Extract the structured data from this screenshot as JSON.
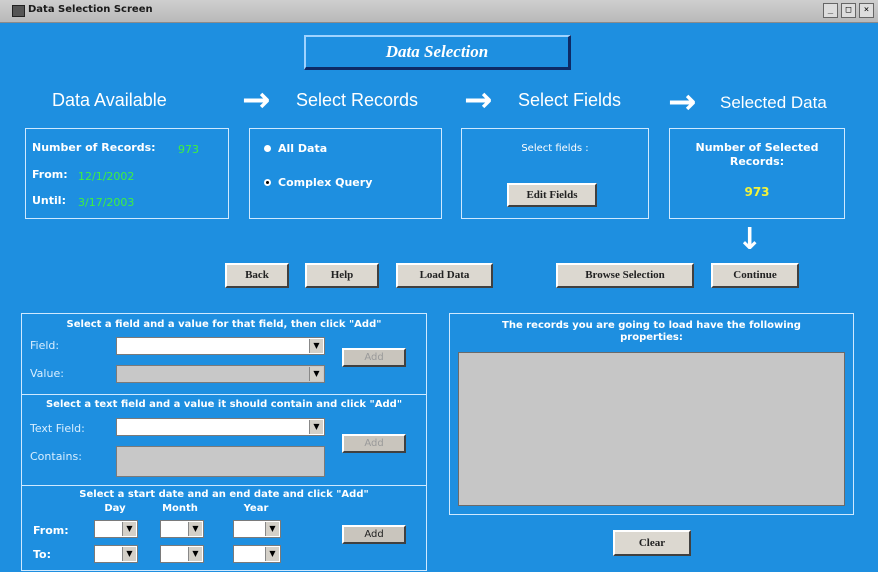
{
  "window": {
    "title": "Data Selection Screen",
    "controls": [
      "_",
      "□",
      "×"
    ]
  },
  "banner": {
    "title": "Data Selection"
  },
  "steps": {
    "data_available": "Data Available",
    "select_records": "Select Records",
    "select_fields": "Select Fields",
    "selected_data": "Selected Data"
  },
  "available": {
    "num_label": "Number of Records:",
    "num_value": "973",
    "from_label": "From:",
    "from_value": "12/1/2002",
    "until_label": "Until:",
    "until_value": "3/17/2003"
  },
  "records": {
    "all_data": "All Data",
    "complex_query": "Complex Query",
    "selected": "complex_query"
  },
  "fields": {
    "prompt": "Select fields :",
    "edit_button": "Edit Fields"
  },
  "selected": {
    "label": "Number of Selected Records:",
    "value": "973"
  },
  "buttons": {
    "back": "Back",
    "help": "Help",
    "load_data": "Load Data",
    "browse_selection": "Browse Selection",
    "continue": "Continue",
    "clear": "Clear"
  },
  "query": {
    "field_value": {
      "title": "Select a field and a value for that field, then click \"Add\"",
      "field_label": "Field:",
      "value_label": "Value:",
      "add": "Add"
    },
    "text_field": {
      "title": "Select a text field and a value it should contain and click \"Add\"",
      "field_label": "Text Field:",
      "contains_label": "Contains:",
      "add": "Add"
    },
    "date_range": {
      "title": "Select a start date and an end date and click \"Add\"",
      "col_day": "Day",
      "col_month": "Month",
      "col_year": "Year",
      "from_label": "From:",
      "to_label": "To:",
      "add": "Add"
    }
  },
  "properties": {
    "title": "The records you are going to load have the following properties:"
  },
  "colors": {
    "background": "#1e8fe0",
    "value_green": "#3ff03f",
    "value_yellow": "#f2f23a"
  }
}
